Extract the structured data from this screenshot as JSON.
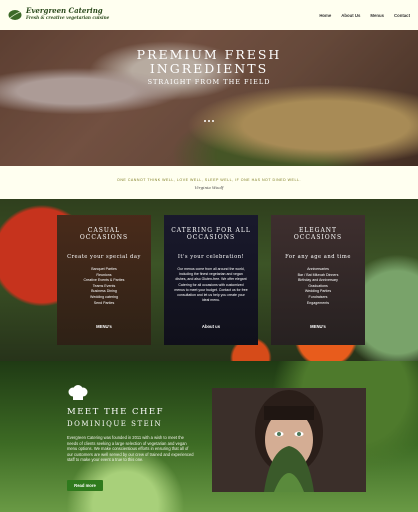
{
  "header": {
    "brand_name": "Evergreen Catering",
    "brand_tagline": "Fresh & creative vegetarian cuisine",
    "nav": [
      "Home",
      "About Us",
      "Menus",
      "Contact"
    ]
  },
  "hero": {
    "title_line_1": "PREMIUM FRESH",
    "title_line_2": "INGREDIENTS",
    "subtitle": "STRAIGHT FROM THE FIELD",
    "slide_count": 3
  },
  "quote": {
    "text": "ONE CANNOT THINK WELL, LOVE WELL, SLEEP WELL, IF ONE HAS NOT DINED WELL.",
    "author": "Virginia Woolf"
  },
  "occasions": {
    "cards": [
      {
        "title_1": "CASUAL",
        "title_2": "OCCASIONS",
        "subtitle": "Create your special day",
        "items": [
          "Banquet Parties",
          "Reunions",
          "Creative Events & Parties",
          "Teams Events",
          "Business Dining",
          "Wedding catering",
          "Send Parties"
        ],
        "button": "MENU's"
      },
      {
        "title_1": "CATERING FOR ALL",
        "title_2": "OCCASIONS",
        "subtitle": "It's your celebration!",
        "text": "Our menus come from all around the world, including the finest vegetarian and vegan dishes, and also Gluten-free. We offer elegant Catering for all occasions with customized menus to meet your budget. Contact us for free consultation and let us help you create your ideal menu.",
        "button": "About us"
      },
      {
        "title_1": "ELEGANT",
        "title_2": "OCCASIONS",
        "subtitle": "For any age and time",
        "items": [
          "Anniversaries",
          "Bar / Bat Mitzvah Dinners",
          "Birthday and Anniversary",
          "Graduations",
          "Wedding Parties",
          "Fundraisers",
          "Engagements"
        ],
        "button": "MENU's"
      }
    ]
  },
  "chef": {
    "title": "MEET THE CHEF",
    "name": "DOMINIQUE STEIN",
    "text": "Evergreen Catering was founded in 2011 with a wish to meet the needs of clients seeking a large selection of vegetarian and vegan menu options. We make conscientious efforts in ensuring that all of our customers are well served by our crew of trained and experienced staff to make your event a true to this one.",
    "button": "Read more"
  },
  "colors": {
    "header_bg": "#fffff0",
    "brand_green": "#2b4a1c",
    "quote_color": "#7e7c22",
    "button_green": "#2f7a1d"
  }
}
